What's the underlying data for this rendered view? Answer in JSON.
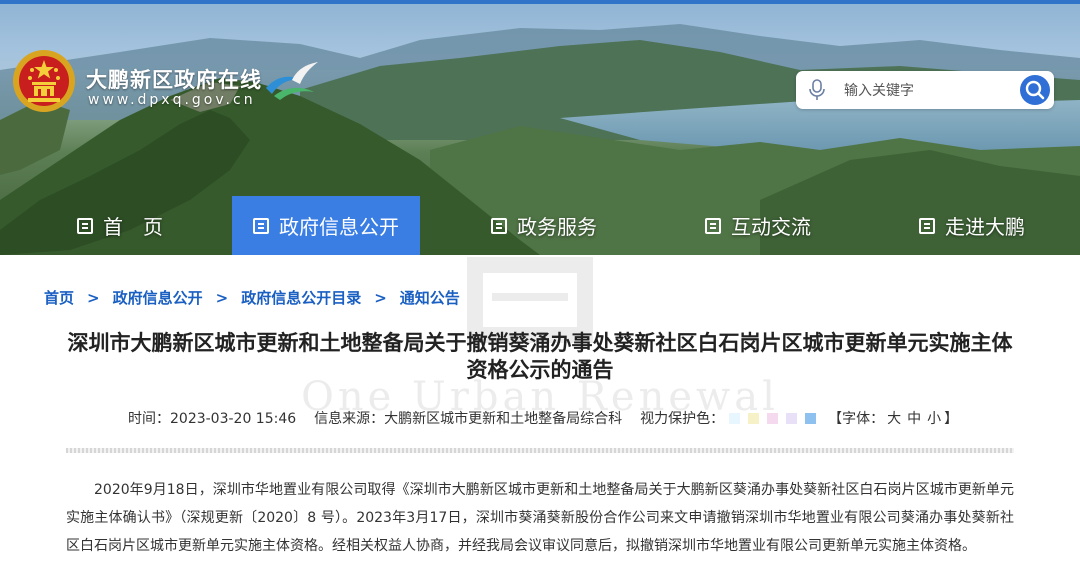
{
  "header": {
    "site_name": "大鹏新区政府在线",
    "site_url": "www.dpxq.gov.cn",
    "search_placeholder": "输入关键字"
  },
  "nav": {
    "items": [
      {
        "label": "首　页",
        "active": false
      },
      {
        "label": "政府信息公开",
        "active": true
      },
      {
        "label": "政务服务",
        "active": false
      },
      {
        "label": "互动交流",
        "active": false
      },
      {
        "label": "走进大鹏",
        "active": false
      }
    ]
  },
  "breadcrumb": [
    "首页",
    "政府信息公开",
    "政府信息公开目录",
    "通知公告"
  ],
  "breadcrumb_separator": ">",
  "article": {
    "title": "深圳市大鹏新区城市更新和土地整备局关于撤销葵涌办事处葵新社区白石岗片区城市更新单元实施主体资格公示的通告",
    "time_label": "时间：",
    "time": "2023-03-20 15:46",
    "source_label": "信息来源：",
    "source": "大鹏新区城市更新和土地整备局综合科",
    "eye_label": "视力保护色：",
    "eye_colors": [
      "#e8f6ff",
      "#f7f1c8",
      "#f5d9ef",
      "#e7e0f7",
      "#8fc1f0"
    ],
    "font_open": "【字体：",
    "font_sizes": [
      "大",
      "中",
      "小"
    ],
    "font_close": "】",
    "body": "2020年9月18日，深圳市华地置业有限公司取得《深圳市大鹏新区城市更新和土地整备局关于大鹏新区葵涌办事处葵新社区白石岗片区城市更新单元实施主体确认书》（深规更新〔2020〕8 号）。2023年3月17日，深圳市葵涌葵新股份合作公司来文申请撤销深圳市华地置业有限公司葵涌办事处葵新社区白石岗片区城市更新单元实施主体资格。经相关权益人协商，并经我局会议审议同意后，拟撤销深圳市华地置业有限公司更新单元实施主体资格。",
    "watermark_text": "One Urban Renewal"
  },
  "colors": {
    "accent": "#3a7ee4",
    "link": "#1a5fc2",
    "top_line": "#2f74c8"
  },
  "icons": [
    "national-emblem-icon",
    "district-logo-icon",
    "microphone-icon",
    "search-icon",
    "list-icon"
  ]
}
